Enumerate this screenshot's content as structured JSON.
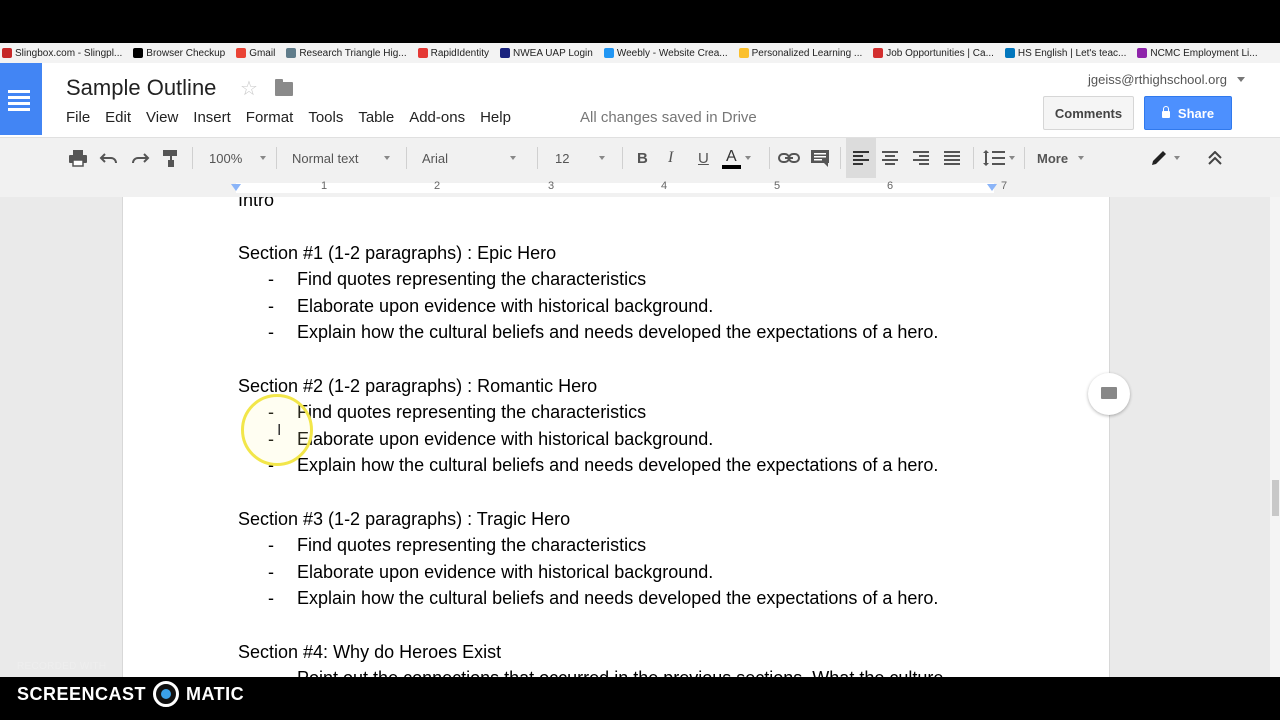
{
  "bookmarks": [
    {
      "label": "Slingbox.com - Slingpl...",
      "color": "#c62828"
    },
    {
      "label": "Browser Checkup",
      "color": "#000000"
    },
    {
      "label": "Gmail",
      "color": "#ea4335"
    },
    {
      "label": "Research Triangle Hig...",
      "color": "#607d8b"
    },
    {
      "label": "RapidIdentity",
      "color": "#e53935"
    },
    {
      "label": "NWEA UAP Login",
      "color": "#1a237e"
    },
    {
      "label": "Weebly - Website Crea...",
      "color": "#2196f3"
    },
    {
      "label": "Personalized Learning ...",
      "color": "#fbc02d"
    },
    {
      "label": "Job Opportunities | Ca...",
      "color": "#d32f2f"
    },
    {
      "label": "HS English | Let's teac...",
      "color": "#0277bd"
    },
    {
      "label": "NCMC Employment Li...",
      "color": "#8e24aa"
    }
  ],
  "header": {
    "title": "Sample Outline",
    "menu": [
      "File",
      "Edit",
      "View",
      "Insert",
      "Format",
      "Tools",
      "Table",
      "Add-ons",
      "Help"
    ],
    "save_status": "All changes saved in Drive",
    "user_email": "jgeiss@rthighschool.org",
    "comments_label": "Comments",
    "share_label": "Share"
  },
  "toolbar": {
    "zoom": "100%",
    "style": "Normal text",
    "font": "Arial",
    "size": "12",
    "bold": "B",
    "italic": "I",
    "underline": "U",
    "text_color": "A",
    "more_label": "More"
  },
  "ruler": {
    "numbers": [
      "1",
      "2",
      "3",
      "4",
      "5",
      "6",
      "7"
    ]
  },
  "document": {
    "intro": "Intro",
    "dash": "-",
    "sections": [
      {
        "heading": "Section #1 (1-2 paragraphs) : Epic Hero",
        "bullets": [
          "Find quotes representing the characteristics",
          "Elaborate upon evidence with historical background.",
          "Explain how the cultural beliefs and needs developed the expectations of a hero."
        ]
      },
      {
        "heading": "Section #2 (1-2 paragraphs) : Romantic Hero",
        "bullets": [
          "Find quotes representing the characteristics",
          "Elaborate upon evidence with historical background.",
          "Explain how the cultural beliefs and needs developed the expectations of a hero."
        ]
      },
      {
        "heading": "Section #3 (1-2 paragraphs) : Tragic Hero",
        "bullets": [
          "Find quotes representing the characteristics",
          "Elaborate upon evidence with historical background.",
          "Explain how the cultural beliefs and needs developed the expectations of a hero."
        ]
      },
      {
        "heading": "Section #4: Why do Heroes Exist",
        "bullets": [
          "Point out the connections that occurred in the previous sections. What the culture"
        ]
      }
    ]
  },
  "watermark": {
    "recorded": "RECORDED WITH",
    "brand_left": "SCREENCAST",
    "brand_right": "MATIC"
  }
}
